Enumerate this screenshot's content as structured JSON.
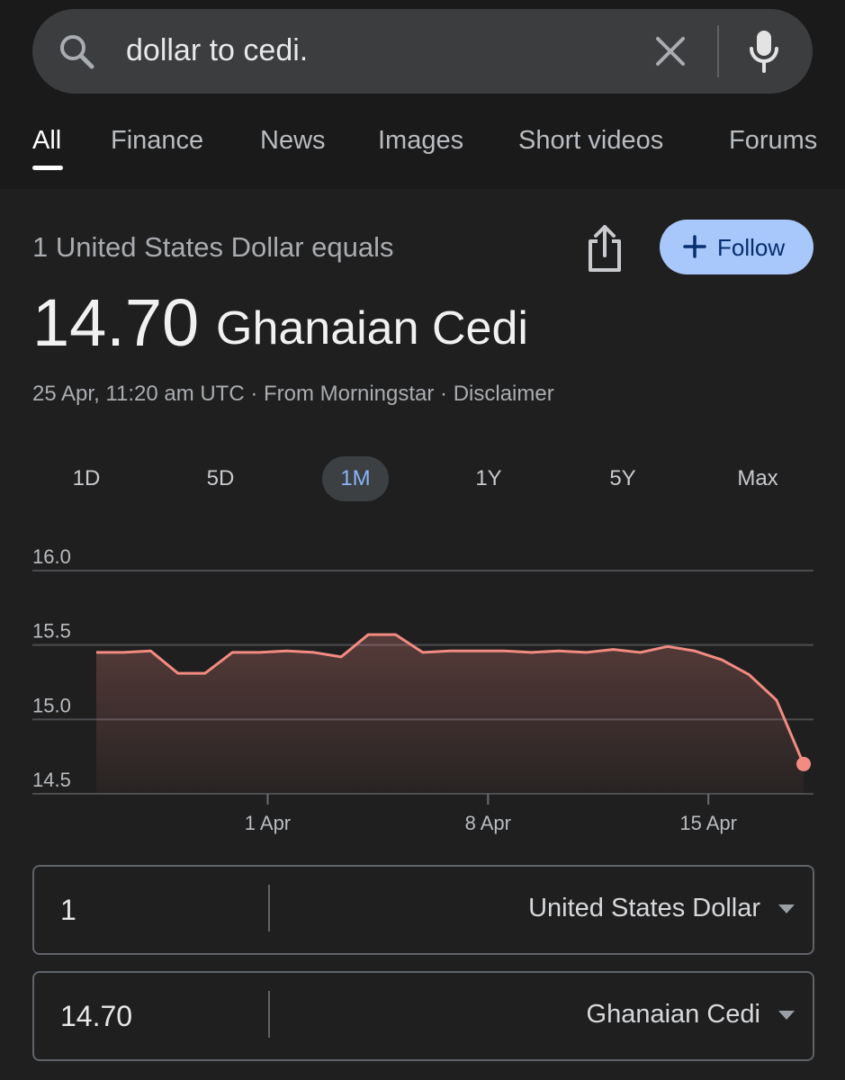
{
  "search": {
    "query": "dollar to cedi.",
    "icon": "search-icon",
    "clear_icon": "close-icon",
    "voice_icon": "mic-icon"
  },
  "tabs": [
    {
      "label": "All",
      "active": true
    },
    {
      "label": "Finance",
      "active": false
    },
    {
      "label": "News",
      "active": false
    },
    {
      "label": "Images",
      "active": false
    },
    {
      "label": "Short videos",
      "active": false
    },
    {
      "label": "Forums",
      "active": false
    }
  ],
  "currency": {
    "equals_text": "1 United States Dollar equals",
    "rate": "14.70",
    "target_currency": "Ghanaian Cedi",
    "meta": "25 Apr, 11:20 am UTC · From Morningstar · Disclaimer",
    "follow_label": "Follow",
    "share_icon": "share-icon"
  },
  "ranges": [
    {
      "label": "1D",
      "active": false
    },
    {
      "label": "5D",
      "active": false
    },
    {
      "label": "1M",
      "active": true
    },
    {
      "label": "1Y",
      "active": false
    },
    {
      "label": "5Y",
      "active": false
    },
    {
      "label": "Max",
      "active": false
    }
  ],
  "chart_data": {
    "type": "area",
    "ylim": [
      14.5,
      16.0
    ],
    "yticks": [
      16.0,
      15.5,
      15.0,
      14.5
    ],
    "ytick_labels": [
      "16.0",
      "15.5",
      "15.0",
      "14.5"
    ],
    "xlim": [
      0,
      29
    ],
    "xticks": [
      {
        "x": 6.3,
        "label": "1 Apr"
      },
      {
        "x": 14.4,
        "label": "8 Apr"
      },
      {
        "x": 22.5,
        "label": "15 Apr"
      }
    ],
    "x": [
      0,
      1,
      2,
      3,
      4,
      5,
      6,
      7,
      8,
      9,
      10,
      11,
      12,
      13,
      14,
      15,
      16,
      17,
      18,
      19,
      20,
      21,
      22,
      23,
      24,
      25,
      26,
      27,
      28,
      29
    ],
    "values": [
      15.45,
      15.45,
      15.46,
      15.31,
      15.31,
      15.45,
      15.45,
      15.46,
      15.45,
      15.42,
      15.57,
      15.57,
      15.45,
      15.46,
      15.46,
      15.46,
      15.45,
      15.46,
      15.45,
      15.47,
      15.45,
      15.49,
      15.46,
      15.4,
      15.3,
      15.13,
      14.7
    ],
    "grid": true,
    "line_color": "#f28b82",
    "fill_color": "#f28b82"
  },
  "converter": {
    "from_amount": "1",
    "from_currency": "United States Dollar",
    "to_amount": "14.70",
    "to_currency": "Ghanaian Cedi"
  },
  "colors": {
    "background": "#1f1f1f",
    "accent_blue": "#a8c7fa",
    "active_range_text": "#8ab4f8",
    "chart_line": "#f28b82"
  }
}
